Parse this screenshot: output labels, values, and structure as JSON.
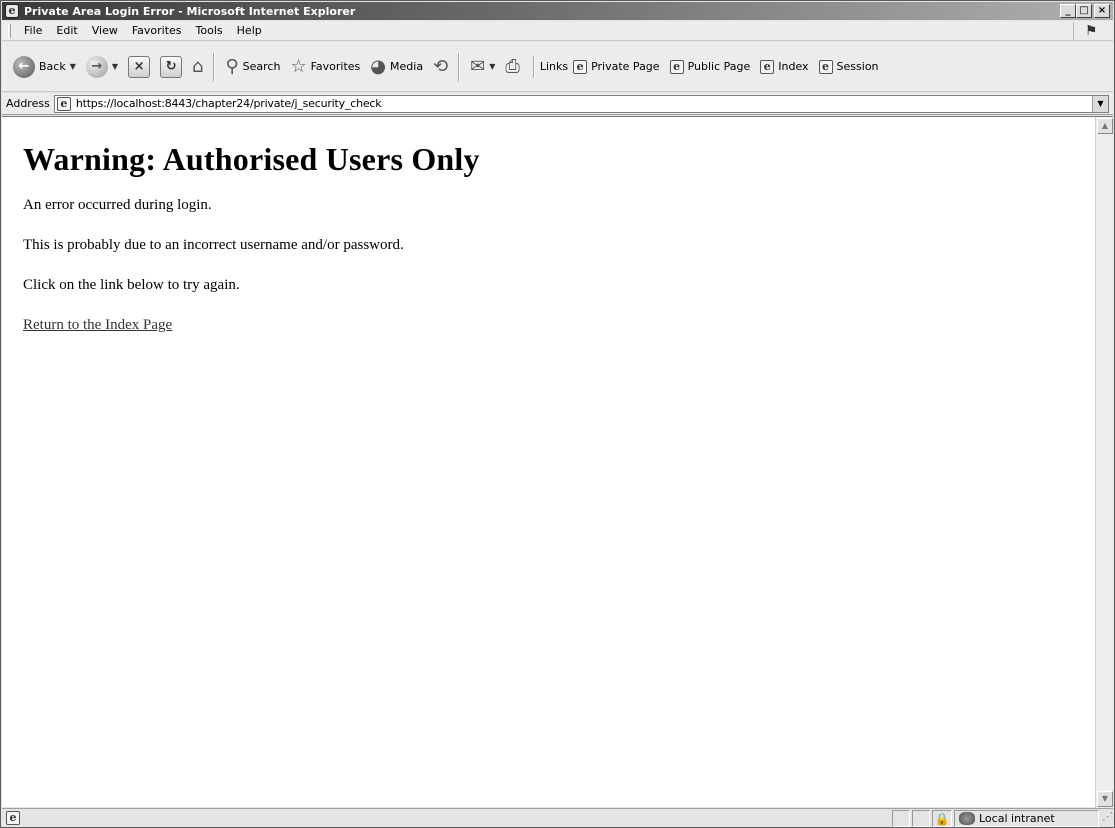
{
  "window": {
    "title": "Private Area Login Error - Microsoft Internet Explorer",
    "controls": {
      "minimize": "_",
      "maximize": "□",
      "close": "×"
    }
  },
  "menubar": {
    "items": [
      {
        "label": "File"
      },
      {
        "label": "Edit"
      },
      {
        "label": "View"
      },
      {
        "label": "Favorites"
      },
      {
        "label": "Tools"
      },
      {
        "label": "Help"
      }
    ]
  },
  "toolbar": {
    "back": "Back",
    "search": "Search",
    "favorites": "Favorites",
    "media": "Media",
    "links_label": "Links",
    "links": [
      {
        "label": "Private Page"
      },
      {
        "label": "Public Page"
      },
      {
        "label": "Index"
      },
      {
        "label": "Session"
      }
    ]
  },
  "address": {
    "label": "Address",
    "url": "https://localhost:8443/chapter24/private/j_security_check"
  },
  "page": {
    "heading": "Warning: Authorised Users Only",
    "paragraphs": [
      "An error occurred during login.",
      "This is probably due to an incorrect username and/or password.",
      "Click on the link below to try again."
    ],
    "link": "Return to the Index Page"
  },
  "status": {
    "zone": "Local intranet"
  }
}
